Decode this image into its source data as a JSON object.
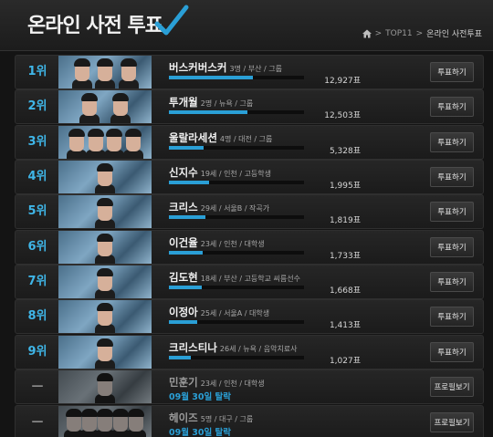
{
  "header": {
    "title": "온라인 사전 투표",
    "breadcrumb": {
      "level1": "TOP11",
      "separator": ">",
      "current": "온라인 사전투표"
    }
  },
  "colors": {
    "accent": "#2a9fd6",
    "rank": "#3fb6e8",
    "background": "#141414"
  },
  "contestants": [
    {
      "rank": "1위",
      "name": "버스커버스커",
      "meta": "3명 / 부산 / 그룹",
      "votes": "12,927표",
      "vote_share": 0.62,
      "button": "투표하기",
      "eliminated": false
    },
    {
      "rank": "2위",
      "name": "투개월",
      "meta": "2명 / 뉴욕 / 그룹",
      "votes": "12,503표",
      "vote_share": 0.58,
      "button": "투표하기",
      "eliminated": false
    },
    {
      "rank": "3위",
      "name": "울랄라세션",
      "meta": "4명 / 대전 / 그룹",
      "votes": "5,328표",
      "vote_share": 0.26,
      "button": "투표하기",
      "eliminated": false
    },
    {
      "rank": "4위",
      "name": "신지수",
      "meta": "19세 / 인천 / 고등학생",
      "votes": "1,995표",
      "vote_share": 0.3,
      "button": "투표하기",
      "eliminated": false
    },
    {
      "rank": "5위",
      "name": "크리스",
      "meta": "29세 / 서울B / 작곡가",
      "votes": "1,819표",
      "vote_share": 0.27,
      "button": "투표하기",
      "eliminated": false
    },
    {
      "rank": "6위",
      "name": "이건율",
      "meta": "23세 / 인천 / 대학생",
      "votes": "1,733표",
      "vote_share": 0.25,
      "button": "투표하기",
      "eliminated": false
    },
    {
      "rank": "7위",
      "name": "김도현",
      "meta": "18세 / 부산 / 고등학교 씨름선수",
      "votes": "1,668표",
      "vote_share": 0.24,
      "button": "투표하기",
      "eliminated": false
    },
    {
      "rank": "8위",
      "name": "이정아",
      "meta": "25세 / 서울A / 대학생",
      "votes": "1,413표",
      "vote_share": 0.21,
      "button": "투표하기",
      "eliminated": false
    },
    {
      "rank": "9위",
      "name": "크리스티나",
      "meta": "26세 / 뉴욕 / 음악치료사",
      "votes": "1,027표",
      "vote_share": 0.16,
      "button": "투표하기",
      "eliminated": false
    },
    {
      "rank": "—",
      "name": "민훈기",
      "meta": "23세 / 인천 / 대학생",
      "status": "09월 30일 탈락",
      "button": "프로필보기",
      "eliminated": true
    },
    {
      "rank": "—",
      "name": "헤이즈",
      "meta": "5명 / 대구 / 그룹",
      "status": "09월 30일 탈락",
      "button": "프로필보기",
      "eliminated": true
    }
  ]
}
